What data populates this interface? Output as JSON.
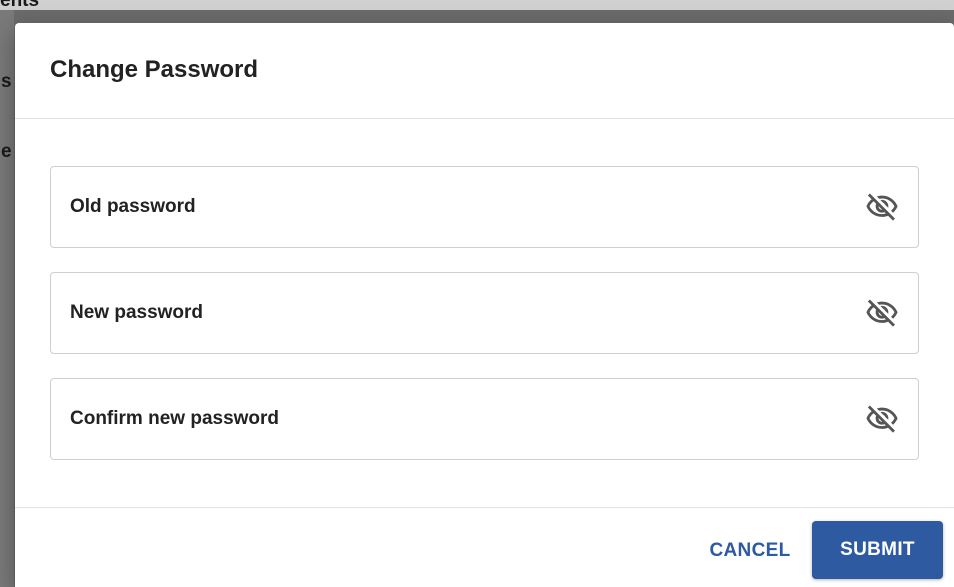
{
  "dialog": {
    "title": "Change Password",
    "fields": [
      {
        "label": "Old password",
        "visibility_icon": "eye-off-icon"
      },
      {
        "label": "New password",
        "visibility_icon": "eye-off-icon"
      },
      {
        "label": "Confirm new password",
        "visibility_icon": "eye-off-icon"
      }
    ],
    "cancel_label": "CANCEL",
    "submit_label": "SUBMIT"
  },
  "background": {
    "fragments": [
      "ents",
      "s",
      "e"
    ]
  },
  "colors": {
    "accent": "#2d5aa0",
    "icon": "#555555",
    "overlay": "#6b6b6b",
    "text": "#222222"
  }
}
